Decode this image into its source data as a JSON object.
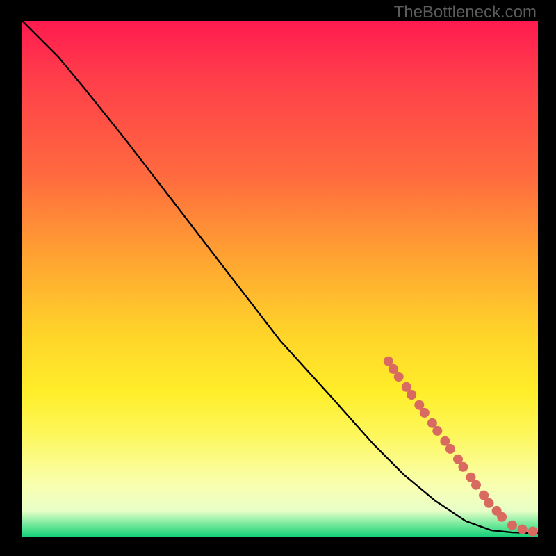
{
  "watermark": "TheBottleneck.com",
  "chart_data": {
    "type": "line",
    "title": "",
    "xlabel": "",
    "ylabel": "",
    "xlim": [
      0,
      100
    ],
    "ylim": [
      0,
      100
    ],
    "series": [
      {
        "name": "curve",
        "values": [
          {
            "x": 0,
            "y": 100
          },
          {
            "x": 3,
            "y": 97
          },
          {
            "x": 7,
            "y": 93
          },
          {
            "x": 12,
            "y": 87
          },
          {
            "x": 20,
            "y": 77
          },
          {
            "x": 30,
            "y": 64
          },
          {
            "x": 40,
            "y": 51
          },
          {
            "x": 50,
            "y": 38
          },
          {
            "x": 60,
            "y": 27
          },
          {
            "x": 68,
            "y": 18
          },
          {
            "x": 74,
            "y": 12
          },
          {
            "x": 80,
            "y": 7
          },
          {
            "x": 86,
            "y": 3
          },
          {
            "x": 91,
            "y": 1.2
          },
          {
            "x": 95,
            "y": 0.8
          },
          {
            "x": 98,
            "y": 0.7
          },
          {
            "x": 100,
            "y": 0.6
          }
        ]
      }
    ],
    "markers": [
      {
        "x": 71,
        "y": 34
      },
      {
        "x": 72,
        "y": 32.5
      },
      {
        "x": 73,
        "y": 31
      },
      {
        "x": 74.5,
        "y": 29
      },
      {
        "x": 75.5,
        "y": 27.5
      },
      {
        "x": 77,
        "y": 25.5
      },
      {
        "x": 78,
        "y": 24
      },
      {
        "x": 79.5,
        "y": 22
      },
      {
        "x": 80.5,
        "y": 20.5
      },
      {
        "x": 82,
        "y": 18.5
      },
      {
        "x": 83,
        "y": 17
      },
      {
        "x": 84.5,
        "y": 15
      },
      {
        "x": 85.5,
        "y": 13.5
      },
      {
        "x": 87,
        "y": 11.5
      },
      {
        "x": 88,
        "y": 10
      },
      {
        "x": 89.5,
        "y": 8
      },
      {
        "x": 90.5,
        "y": 6.5
      },
      {
        "x": 92,
        "y": 5
      },
      {
        "x": 93,
        "y": 3.8
      },
      {
        "x": 95,
        "y": 2.2
      },
      {
        "x": 97,
        "y": 1.4
      },
      {
        "x": 99,
        "y": 1.0
      }
    ],
    "marker_color": "#d86a60",
    "line_color": "#000000"
  }
}
